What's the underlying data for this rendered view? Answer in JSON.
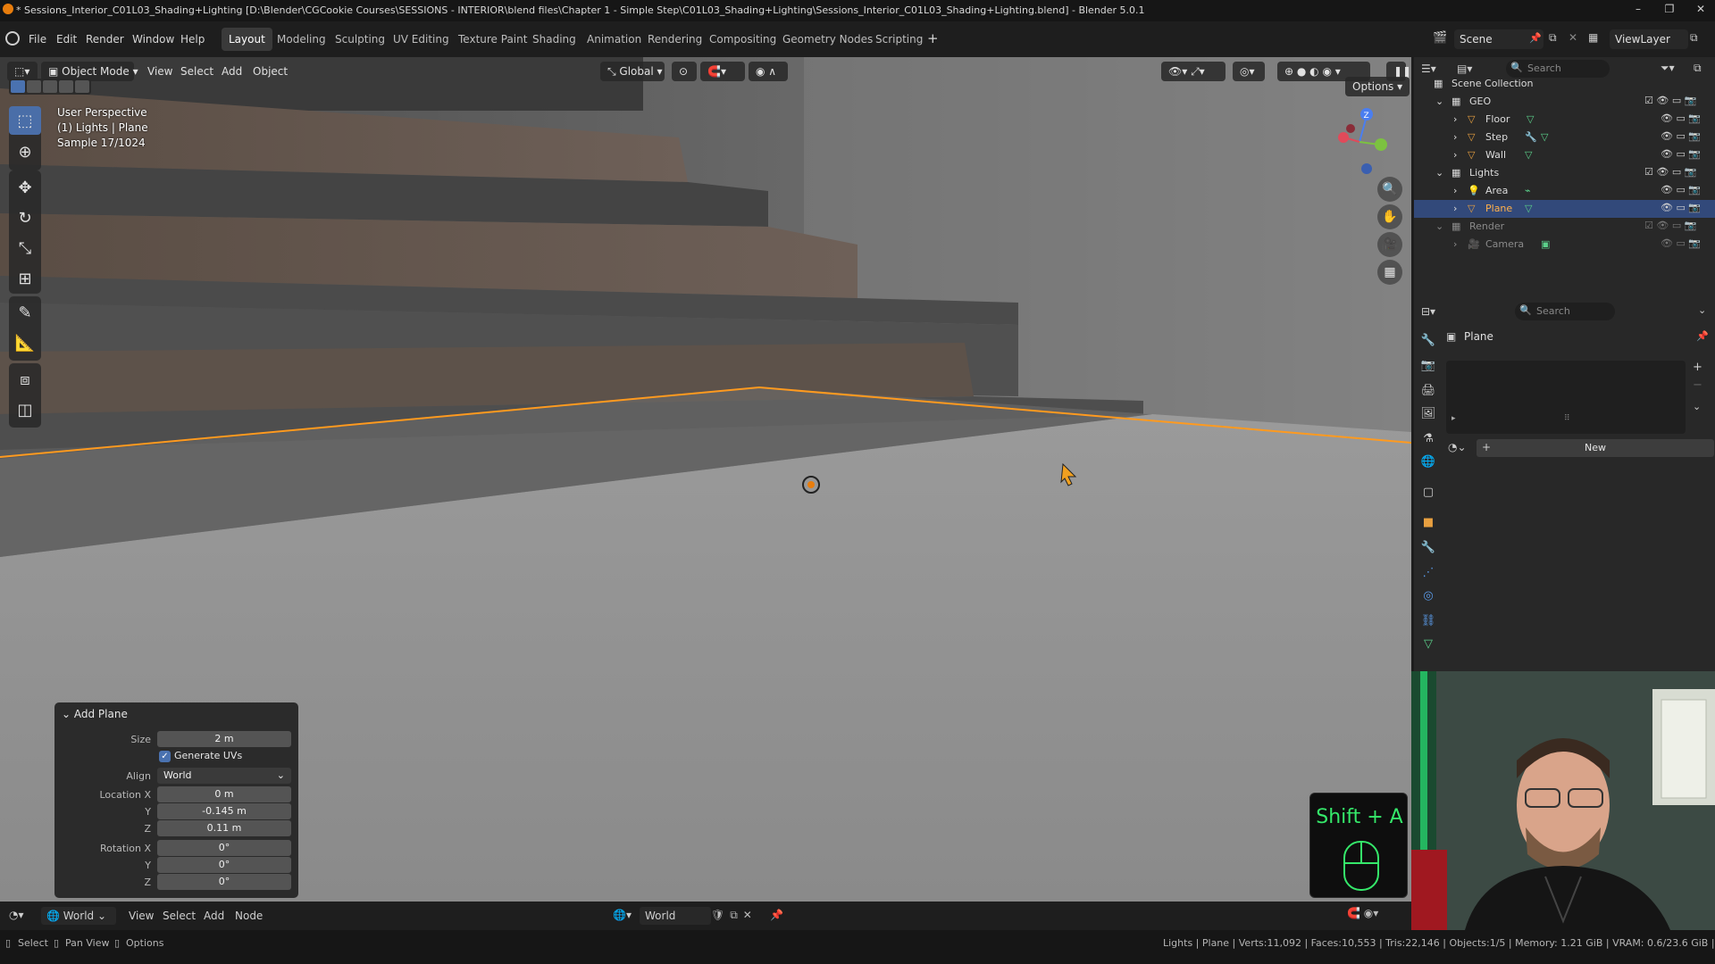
{
  "titlebar": {
    "title": "* Sessions_Interior_C01L03_Shading+Lighting [D:\\Blender\\CGCookie Courses\\SESSIONS - INTERIOR\\blend files\\Chapter 1 - Simple Step\\C01L03_Shading+Lighting\\Sessions_Interior_C01L03_Shading+Lighting.blend] - Blender 5.0.1"
  },
  "menu": [
    "File",
    "Edit",
    "Render",
    "Window",
    "Help"
  ],
  "workspaces": [
    "Layout",
    "Modeling",
    "Sculpting",
    "UV Editing",
    "Texture Paint",
    "Shading",
    "Animation",
    "Rendering",
    "Compositing",
    "Geometry Nodes",
    "Scripting"
  ],
  "active_workspace": "Layout",
  "scene_name": "Scene",
  "viewlayer_name": "ViewLayer",
  "viewport": {
    "mode": "Object Mode",
    "menus": [
      "View",
      "Select",
      "Add",
      "Object"
    ],
    "transform_orientation": "Global",
    "options_label": "Options",
    "perspective": "User Perspective",
    "context": "(1) Lights | Plane",
    "sample": "Sample 17/1024",
    "gizmo_axis": "Z"
  },
  "operator_panel": {
    "title": "Add Plane",
    "size_label": "Size",
    "size": "2 m",
    "generate_uvs_label": "Generate UVs",
    "generate_uvs": true,
    "align_label": "Align",
    "align": "World",
    "location_label": "Location X",
    "location": [
      "0 m",
      "-0.145 m",
      "0.11 m"
    ],
    "rotation_label": "Rotation X",
    "rotation": [
      "0°",
      "0°",
      "0°"
    ],
    "y_label": "Y",
    "z_label": "Z"
  },
  "shortcut": "Shift + A",
  "bottom_editor": {
    "world_label": "World",
    "menus": [
      "View",
      "Select",
      "Add",
      "Node"
    ],
    "world_datablock": "World"
  },
  "statusbar": {
    "select": "Select",
    "pan": "Pan View",
    "options": "Options",
    "stats": "Lights | Plane | Verts:11,092 | Faces:10,553 | Tris:22,146 | Objects:1/5 | Memory: 1.21 GiB | VRAM: 0.6/23.6 GiB | 5.0.1"
  },
  "outliner": {
    "search_placeholder": "Search",
    "root": "Scene Collection",
    "rows": [
      {
        "name": "GEO",
        "type": "collection"
      },
      {
        "name": "Floor",
        "type": "mesh"
      },
      {
        "name": "Step",
        "type": "mesh"
      },
      {
        "name": "Wall",
        "type": "mesh"
      },
      {
        "name": "Lights",
        "type": "collection"
      },
      {
        "name": "Area",
        "type": "light"
      },
      {
        "name": "Plane",
        "type": "mesh"
      },
      {
        "name": "Render",
        "type": "collection"
      },
      {
        "name": "Camera",
        "type": "camera"
      }
    ],
    "selected": "Plane"
  },
  "properties": {
    "search_placeholder": "Search",
    "object_name": "Plane",
    "new_button": "New"
  },
  "colors": {
    "accent": "#4a72b0",
    "selection_outline": "#ff9a1f",
    "shortcut_text": "#35e86a",
    "selected_row": "#32497a"
  }
}
